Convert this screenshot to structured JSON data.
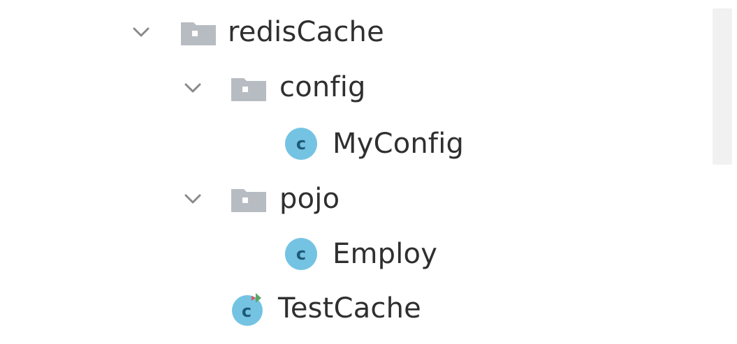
{
  "tree": {
    "nodes": [
      {
        "name": "redisCache",
        "kind": "package",
        "expanded": true
      },
      {
        "name": "config",
        "kind": "package",
        "expanded": true
      },
      {
        "name": "MyConfig",
        "kind": "class"
      },
      {
        "name": "pojo",
        "kind": "package",
        "expanded": true
      },
      {
        "name": "Employ",
        "kind": "class"
      },
      {
        "name": "TestCache",
        "kind": "test-class"
      }
    ]
  },
  "colors": {
    "folder": "#b7bcc2",
    "folder_hole": "#ffffff",
    "class_circle": "#75c3e3",
    "class_letter": "#1f5a78",
    "chevron": "#8a8a8a",
    "test_green": "#59a869",
    "test_red": "#e05555",
    "scrollbar": "#f1f1f1"
  },
  "icons": {
    "chevron": "chevron-down-icon",
    "package": "folder-icon",
    "class": "class-icon",
    "test_class": "test-class-icon"
  }
}
